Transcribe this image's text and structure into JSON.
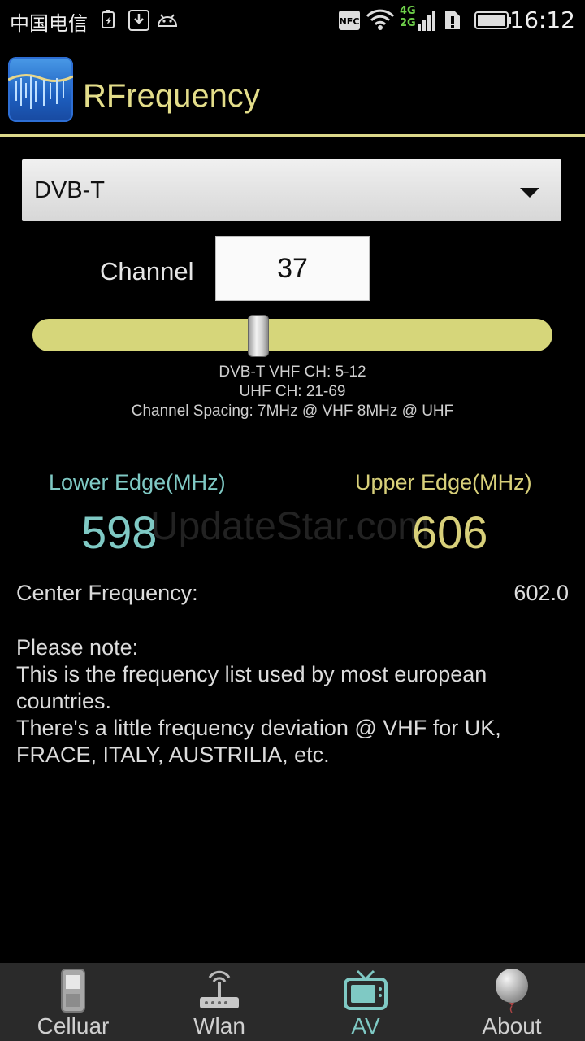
{
  "status_bar": {
    "carrier": "中国电信",
    "time": "16:12",
    "nfc": "NFC",
    "net_4g": "4G",
    "net_2g": "2G"
  },
  "app": {
    "title": "RFrequency"
  },
  "spinner": {
    "selected": "DVB-T"
  },
  "channel": {
    "label": "Channel",
    "value": "37",
    "slider_fraction": 0.43
  },
  "info": {
    "line1": "DVB-T VHF CH: 5-12",
    "line2": "UHF CH: 21-69",
    "line3": "Channel Spacing: 7MHz @ VHF   8MHz @ UHF"
  },
  "edges": {
    "lower_label": "Lower Edge(MHz)",
    "lower_value": "598",
    "upper_label": "Upper Edge(MHz)",
    "upper_value": "606"
  },
  "watermark": "UpdateStar.com",
  "center": {
    "label": "Center Frequency:",
    "value": "602.0"
  },
  "note": {
    "lines": [
      "Please note:",
      "This is the frequency list used by most european",
      "countries.",
      "There's a little frequency deviation @ VHF for UK,",
      "FRACE, ITALY, AUSTRILIA, etc."
    ]
  },
  "tabs": [
    {
      "label": "Celluar",
      "icon": "phone-icon",
      "active": false
    },
    {
      "label": "Wlan",
      "icon": "router-icon",
      "active": false
    },
    {
      "label": "AV",
      "icon": "tv-icon",
      "active": true
    },
    {
      "label": "About",
      "icon": "balloon-icon",
      "active": false
    }
  ],
  "colors": {
    "accent_yellow": "#dcd88a",
    "accent_teal": "#7fc9c4",
    "slider_track": "#d6d67a"
  }
}
